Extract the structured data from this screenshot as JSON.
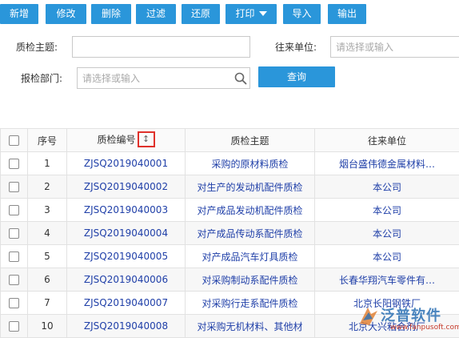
{
  "toolbar": {
    "add": "新增",
    "edit": "修改",
    "delete": "删除",
    "filter": "过滤",
    "restore": "还原",
    "print": "打印",
    "import": "导入",
    "export": "输出"
  },
  "form": {
    "subject_label": "质检主题:",
    "subject_value": "",
    "partner_label": "往来单位:",
    "partner_placeholder": "请选择或输入",
    "dept_label": "报检部门:",
    "dept_placeholder": "请选择或输入",
    "query_label": "查询"
  },
  "grid": {
    "headers": [
      "序号",
      "质检编号",
      "质检主题",
      "往来单位"
    ],
    "sort_glyph": "↕",
    "rows": [
      {
        "no": "1",
        "code": "ZJSQ2019040001",
        "subject": "采购的原材料质检",
        "partner": "烟台盛伟德金属材料…"
      },
      {
        "no": "2",
        "code": "ZJSQ2019040002",
        "subject": "对生产的发动机配件质检",
        "partner": "本公司"
      },
      {
        "no": "3",
        "code": "ZJSQ2019040003",
        "subject": "对产成品发动机配件质检",
        "partner": "本公司"
      },
      {
        "no": "4",
        "code": "ZJSQ2019040004",
        "subject": "对产成品传动系配件质检",
        "partner": "本公司"
      },
      {
        "no": "5",
        "code": "ZJSQ2019040005",
        "subject": "对产成品汽车灯具质检",
        "partner": "本公司"
      },
      {
        "no": "6",
        "code": "ZJSQ2019040006",
        "subject": "对采购制动系配件质检",
        "partner": "长春华翔汽车零件有…"
      },
      {
        "no": "7",
        "code": "ZJSQ2019040007",
        "subject": "对采购行走系配件质检",
        "partner": "北京长阳钢铁厂"
      },
      {
        "no": "10",
        "code": "ZJSQ2019040008",
        "subject": "对采购无机材料、其他材",
        "partner": "北京大兴粘合剂厂"
      }
    ]
  },
  "watermark": {
    "text": "泛普软件",
    "url": "www.fanpusoft.com"
  },
  "colors": {
    "button": "#2a96da",
    "link": "#1f3fa8",
    "sort_highlight": "#e0312b"
  }
}
